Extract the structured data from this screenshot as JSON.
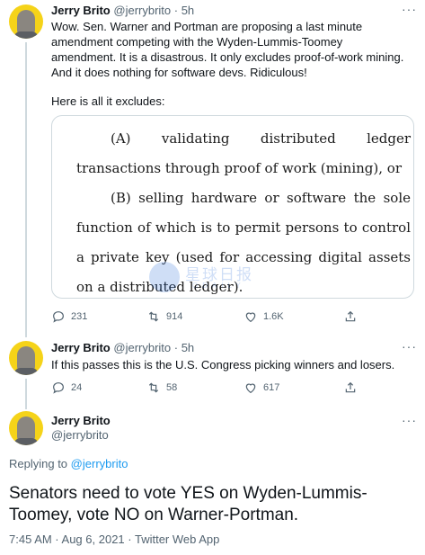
{
  "tweet1": {
    "author_name": "Jerry Brito",
    "handle": "@jerrybrito",
    "time": "· 5h",
    "text_p1": "Wow. Sen. Warner and Portman are proposing a last minute amendment competing with the Wyden-Lummis-Toomey amendment. It is a disastrous. It only excludes proof-of-work mining. And it does nothing for software devs. Ridiculous!",
    "text_p2": "Here is all it excludes:",
    "image": {
      "clause_a": "(A) validating distributed ledger transactions through proof of work (mining), or",
      "clause_b": "(B) selling hardware or software the sole function of which is to permit persons to control a private key (used for accessing digital assets on a distributed ledger).",
      "watermark_text": "星球日报",
      "watermark_sub": "ODAILY"
    },
    "actions": {
      "replies": "231",
      "retweets": "914",
      "likes": "1.6K"
    }
  },
  "tweet2": {
    "author_name": "Jerry Brito",
    "handle": "@jerrybrito",
    "time": "· 5h",
    "text": "If this passes this is the U.S. Congress picking winners and losers.",
    "actions": {
      "replies": "24",
      "retweets": "58",
      "likes": "617"
    }
  },
  "main_tweet": {
    "author_name": "Jerry Brito",
    "handle": "@jerrybrito",
    "replying_prefix": "Replying to",
    "replying_to": "@jerrybrito",
    "text": "Senators need to vote YES on Wyden-Lummis-Toomey, vote NO on Warner-Portman.",
    "meta": "7:45 AM · Aug 6, 2021 · Twitter Web App"
  },
  "colors": {
    "accent": "#1d9bf0",
    "secondary_text": "#536471",
    "avatar_bg": "#f5d319"
  },
  "icons": [
    "reply-icon",
    "retweet-icon",
    "like-icon",
    "share-icon",
    "more-icon"
  ]
}
